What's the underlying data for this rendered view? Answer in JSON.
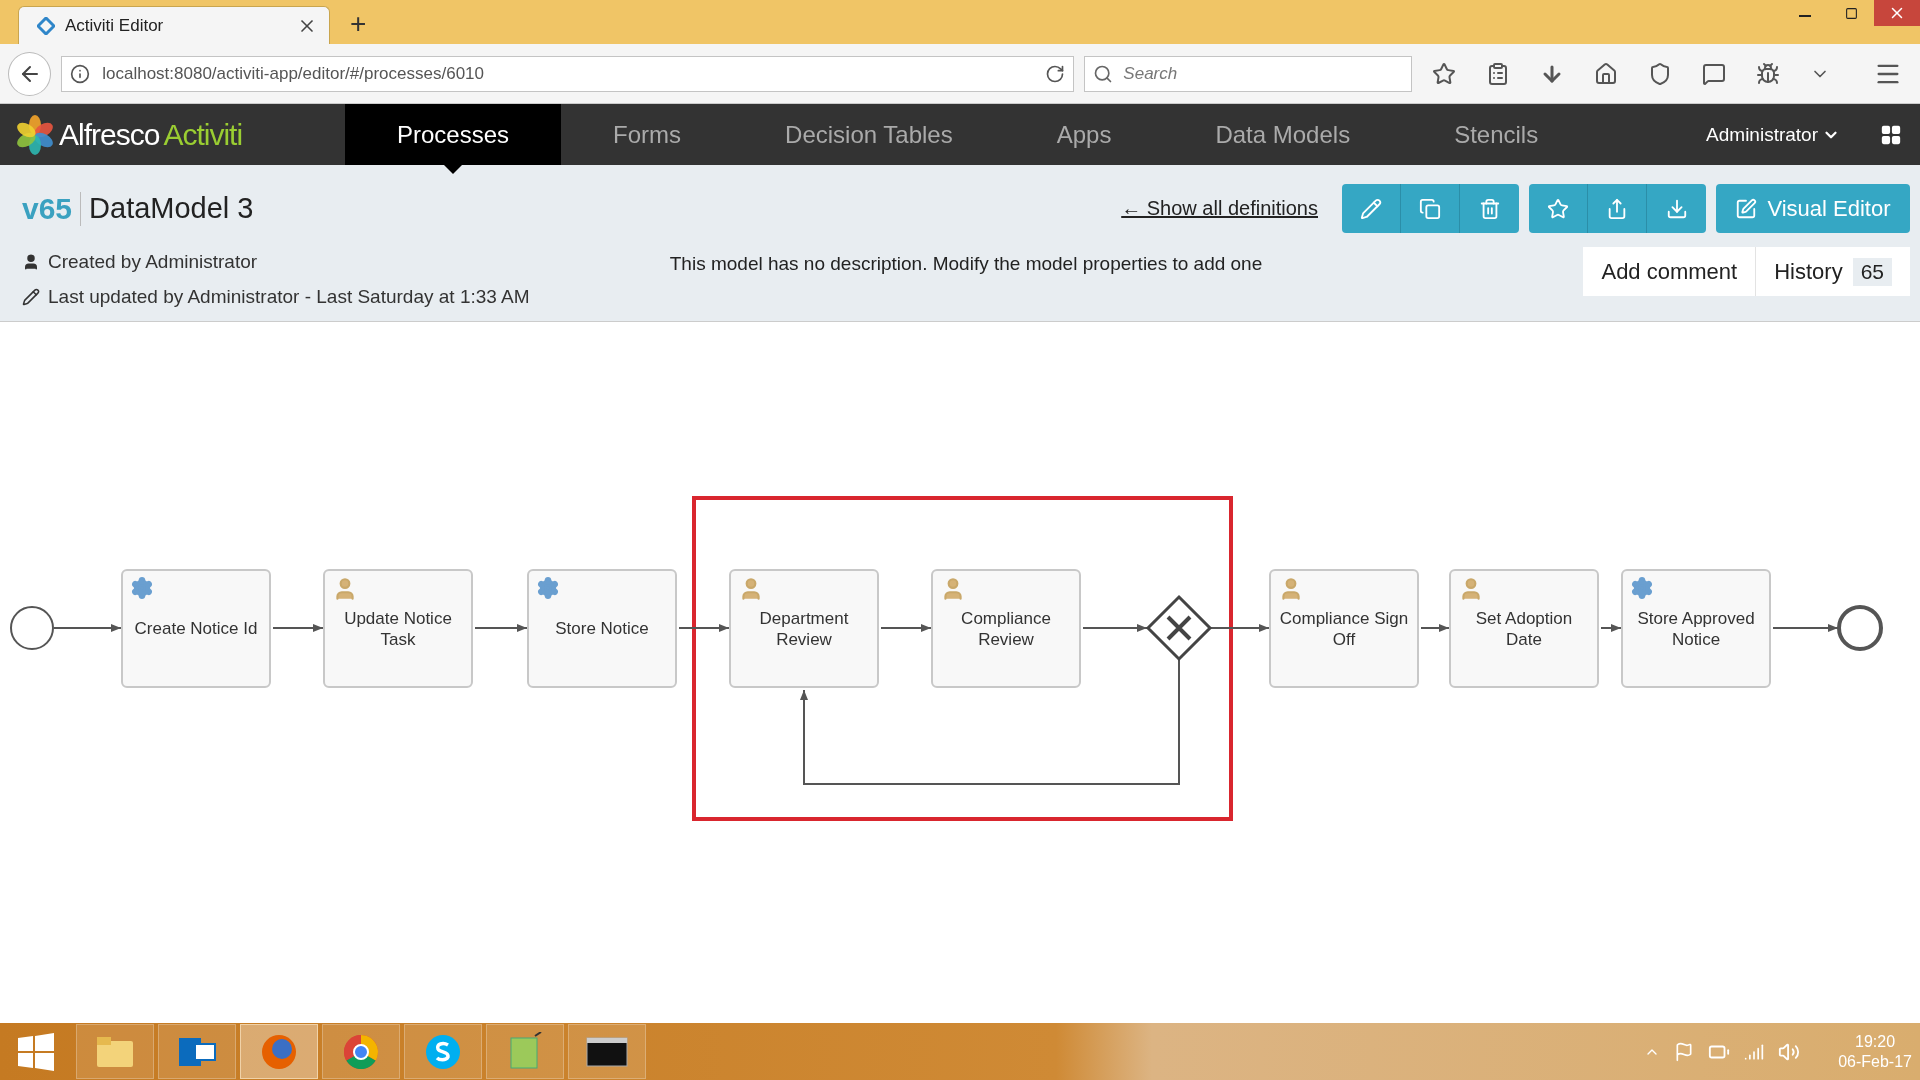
{
  "browser": {
    "tab_title": "Activiti Editor",
    "new_tab": "+",
    "url": "localhost:8080/activiti-app/editor/#/processes/6010",
    "search": {
      "placeholder": "Search"
    }
  },
  "app": {
    "logo": {
      "brand": "Alfresco",
      "product": "Activiti"
    },
    "nav": [
      {
        "label": "Processes",
        "selected": true
      },
      {
        "label": "Forms",
        "selected": false
      },
      {
        "label": "Decision Tables",
        "selected": false
      },
      {
        "label": "Apps",
        "selected": false
      },
      {
        "label": "Data Models",
        "selected": false
      },
      {
        "label": "Stencils",
        "selected": false
      }
    ],
    "user": "Administrator"
  },
  "model": {
    "version": "v65",
    "name": "DataModel 3",
    "back_link": "← Show all definitions",
    "visual_editor": "Visual Editor",
    "created_by": "Created by Administrator",
    "last_updated": "Last updated by Administrator - Last Saturday at 1:33 AM",
    "description": "This model has no description. Modify the model properties to add one",
    "add_comment": "Add comment",
    "history": {
      "label": "History",
      "count": "65"
    }
  },
  "diagram": {
    "nodes": [
      {
        "kind": "start"
      },
      {
        "kind": "service_task",
        "label": "Create Notice Id"
      },
      {
        "kind": "user_task",
        "label": "Update Notice Task"
      },
      {
        "kind": "service_task",
        "label": "Store Notice"
      },
      {
        "kind": "user_task",
        "label": "Department Review"
      },
      {
        "kind": "user_task",
        "label": "Compliance Review"
      },
      {
        "kind": "gateway"
      },
      {
        "kind": "user_task",
        "label": "Compliance Sign Off"
      },
      {
        "kind": "user_task",
        "label": "Set Adoption Date"
      },
      {
        "kind": "service_task",
        "label": "Store Approved Notice"
      },
      {
        "kind": "end"
      }
    ]
  },
  "taskbar": {
    "time": "19:20",
    "date": "06-Feb-17"
  }
}
